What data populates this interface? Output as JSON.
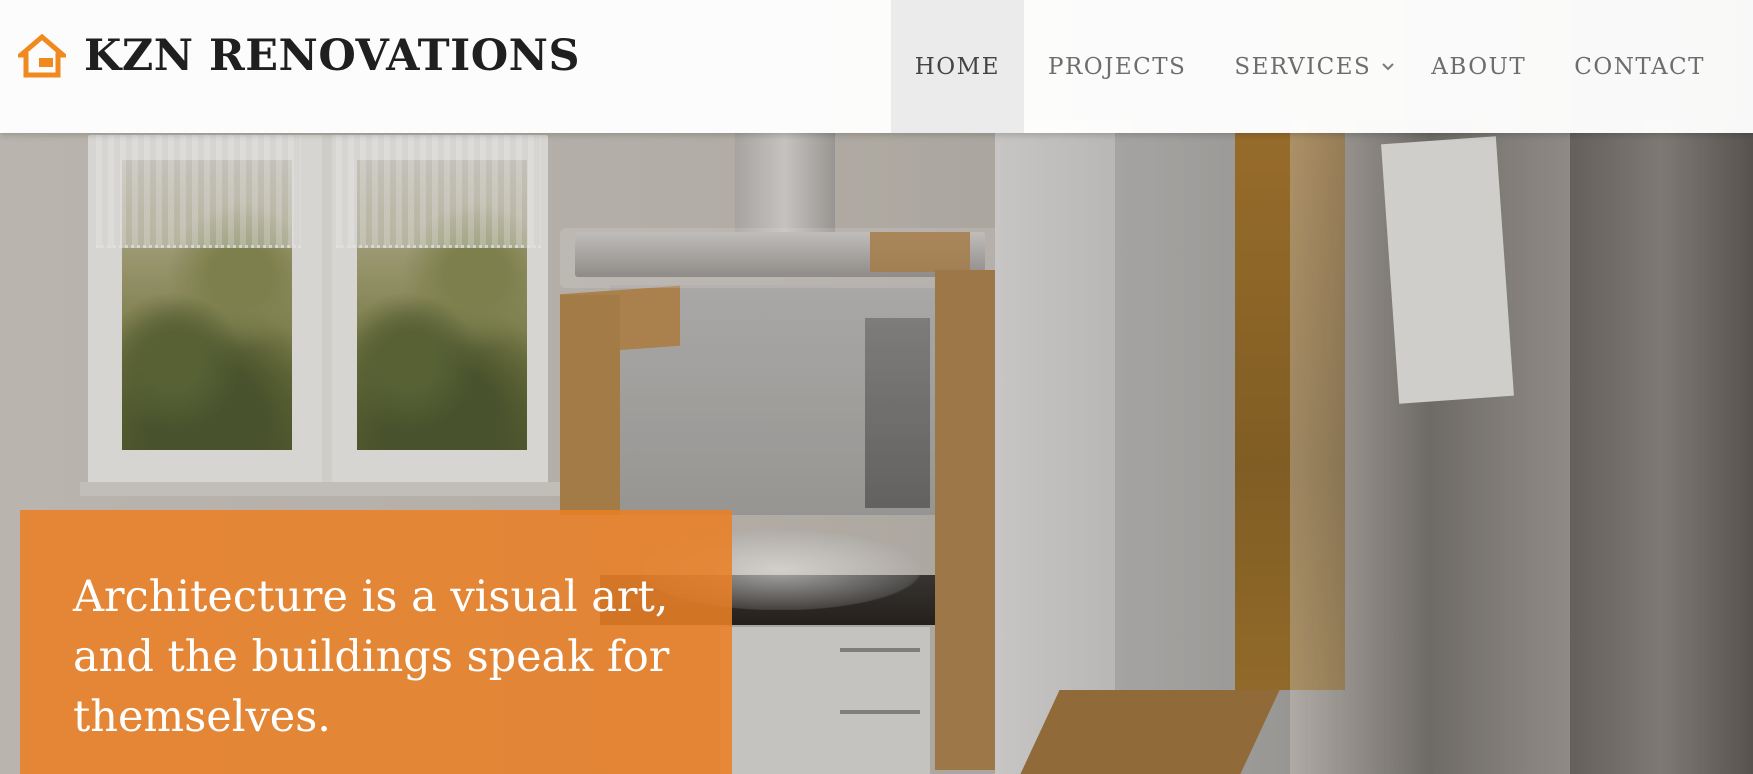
{
  "brand": {
    "name": "KZN RENOVATIONS",
    "icon": "house-icon",
    "color": "#f08a1f"
  },
  "nav": {
    "items": [
      {
        "label": "HOME",
        "active": true
      },
      {
        "label": "PROJECTS",
        "active": false
      },
      {
        "label": "SERVICES",
        "active": false,
        "has_dropdown": true,
        "icon": "chevron-down-icon"
      },
      {
        "label": "ABOUT",
        "active": false
      },
      {
        "label": "CONTACT",
        "active": false
      }
    ]
  },
  "hero": {
    "quote": "Architecture is a visual art, and the buildings speak for themselves.",
    "quote_box_color": "#e98026"
  }
}
